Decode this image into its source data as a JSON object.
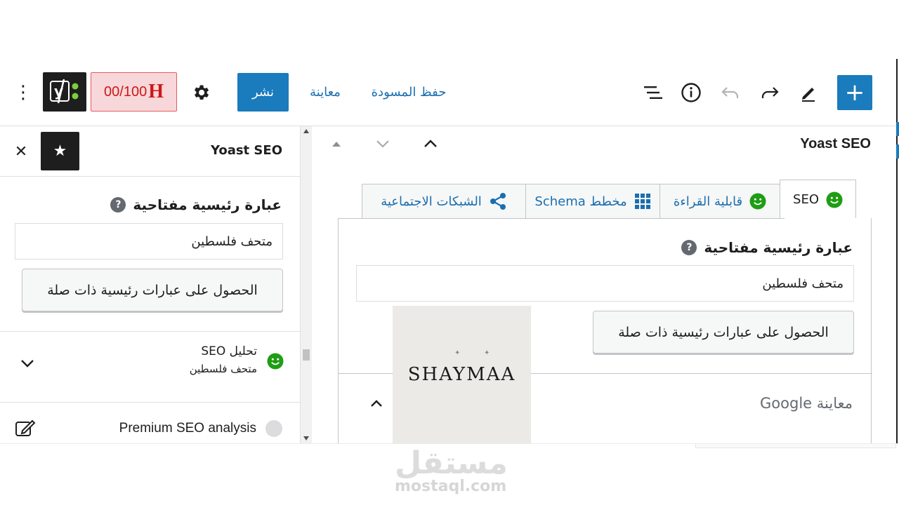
{
  "toolbar": {
    "score": "00/100",
    "score_h": "H",
    "publish": "نشر",
    "preview": "معاينة",
    "save_draft": "حفظ المسودة",
    "add": "+"
  },
  "sidebar": {
    "title": "Yoast SEO",
    "focus_keyphrase_label": "عبارة رئيسية مفتاحية",
    "focus_keyphrase_value": "متحف فلسطين",
    "related_button": "الحصول على عبارات رئيسية ذات صلة",
    "seo_analysis_title": "تحليل SEO",
    "seo_analysis_keyword": "متحف فلسطين",
    "premium_label": "Premium SEO analysis"
  },
  "panel": {
    "title": "Yoast SEO",
    "tabs": [
      {
        "label": "SEO"
      },
      {
        "label": "قابلية القراءة"
      },
      {
        "label": "مخطط Schema"
      },
      {
        "label": "الشبكات الاجتماعية"
      }
    ],
    "focus_keyphrase_label": "عبارة رئيسية مفتاحية",
    "focus_keyphrase_value": "متحف فلسطين",
    "related_button": "الحصول على عبارات رئيسية ذات صلة",
    "google_preview": "معاينة Google"
  },
  "watermark_card": {
    "text": "SHAYMAA"
  },
  "site_watermark": {
    "arabic": "مستقل",
    "latin": "mostaql.com"
  },
  "colors": {
    "primary": "#1a7bbd",
    "link": "#1a6fb0",
    "good": "#1f9d15",
    "bad": "#cc1818"
  }
}
